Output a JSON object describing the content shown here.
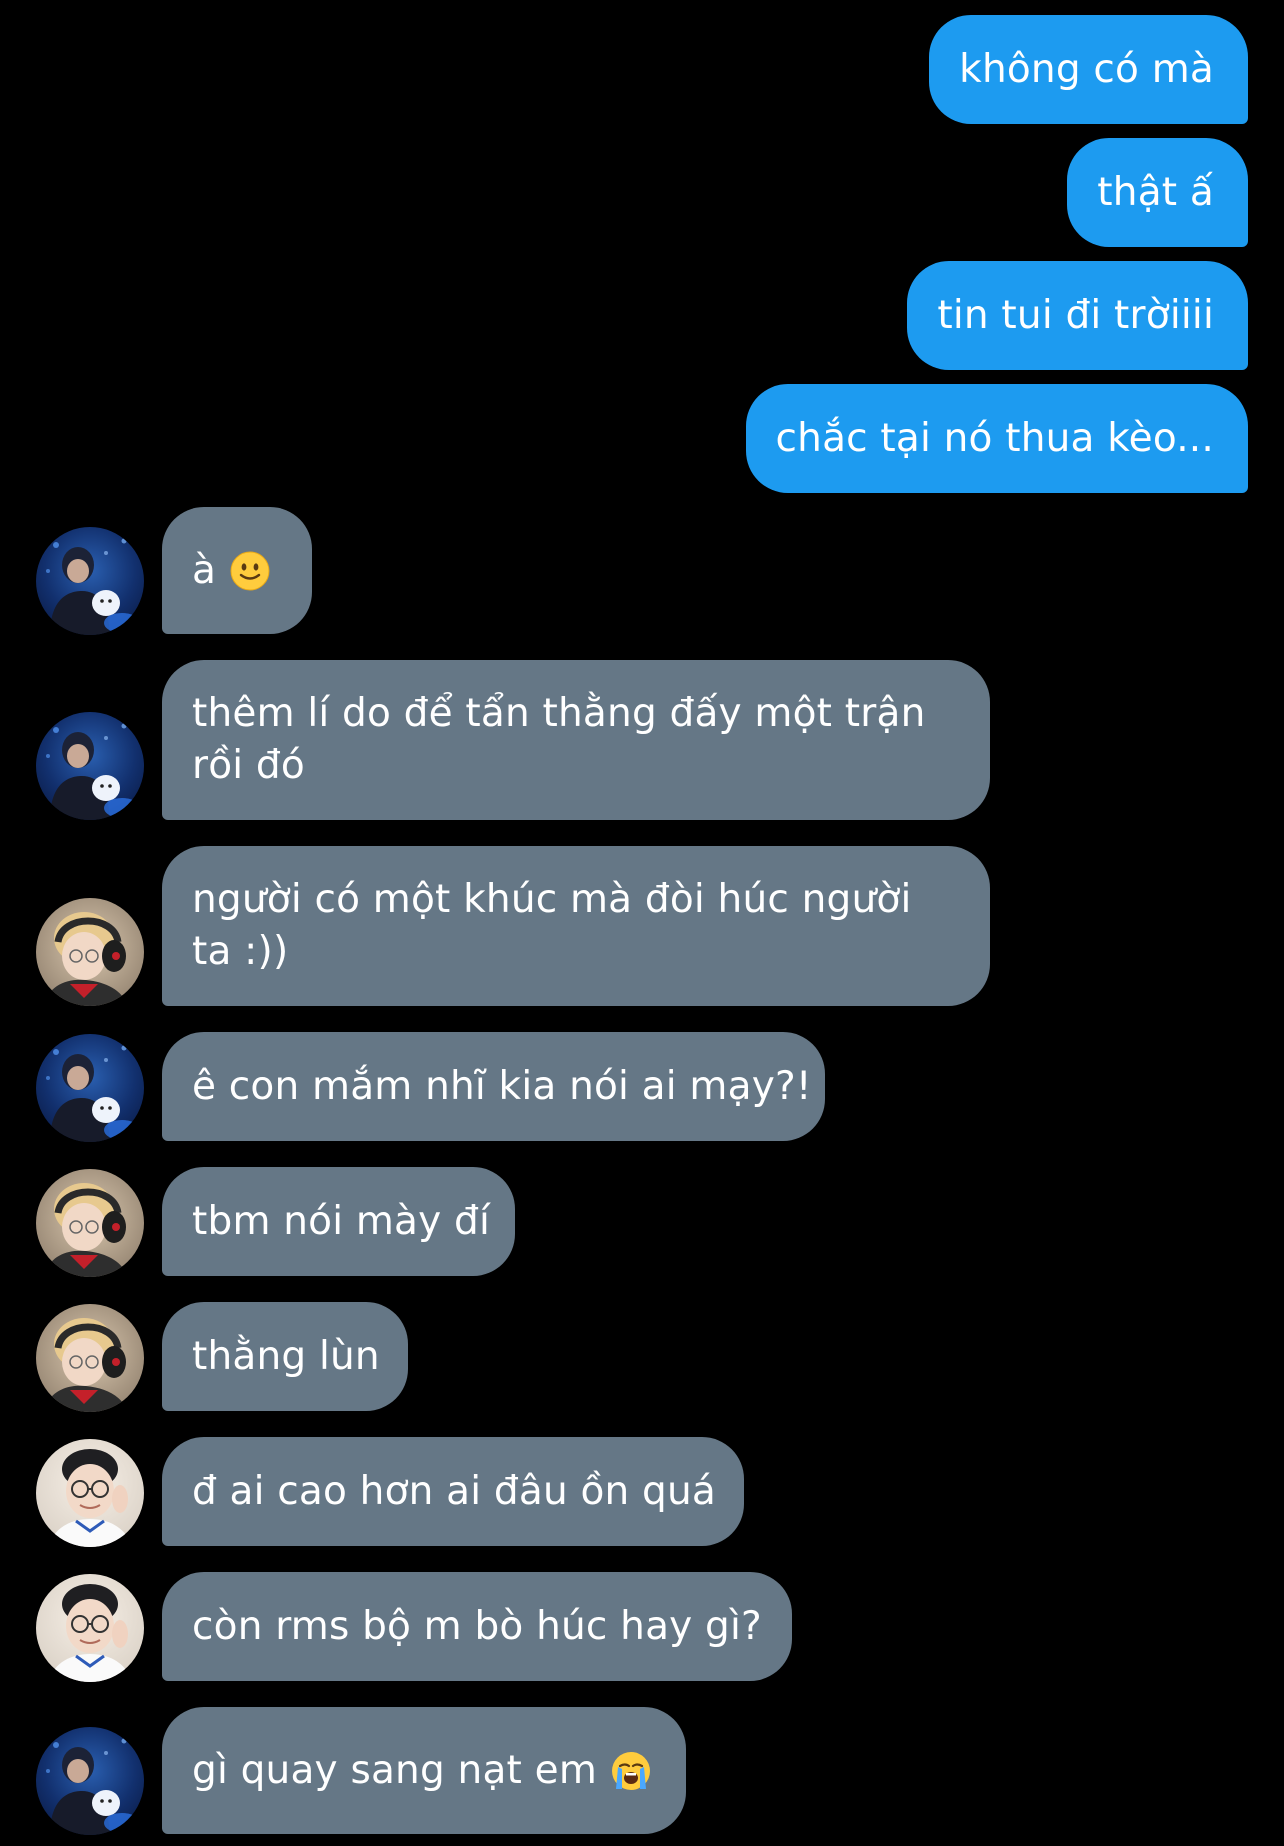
{
  "messages": [
    {
      "side": "out",
      "text": "không có mà"
    },
    {
      "side": "out",
      "text": "thật ấ"
    },
    {
      "side": "out",
      "text": "tin tui đi trờiiii"
    },
    {
      "side": "out",
      "text": "chắc tại nó thua kèo..."
    },
    {
      "side": "in",
      "avatar": "avatar-blue-icon",
      "text": "à",
      "emoji": "slightly-smiling-face-icon"
    },
    {
      "side": "in",
      "avatar": "avatar-blue-icon",
      "line1": "thêm lí do để tẩn thằng đấy một trận",
      "line2": "rồi đó"
    },
    {
      "side": "in",
      "avatar": "avatar-headset-icon",
      "line1": "người có một khúc mà đòi húc người",
      "line2": "ta :))"
    },
    {
      "side": "in",
      "avatar": "avatar-blue-icon",
      "text": "ê con mắm nhĩ kia nói ai mạy?!"
    },
    {
      "side": "in",
      "avatar": "avatar-headset-icon",
      "text": "tbm nói mày đí"
    },
    {
      "side": "in",
      "avatar": "avatar-headset-icon",
      "text": "thằng lùn"
    },
    {
      "side": "in",
      "avatar": "avatar-glasses-icon",
      "text": "đ ai cao hơn ai đâu ồn quá"
    },
    {
      "side": "in",
      "avatar": "avatar-glasses-icon",
      "text": "còn rms bộ m bò húc hay gì?"
    },
    {
      "side": "in",
      "avatar": "avatar-blue-icon",
      "text": "gì quay sang nạt em",
      "emoji": "loudly-crying-face-icon"
    }
  ],
  "colors": {
    "background": "#000000",
    "outgoing_bubble": "#1d9bf0",
    "incoming_bubble": "#657786",
    "text": "#ffffff"
  }
}
